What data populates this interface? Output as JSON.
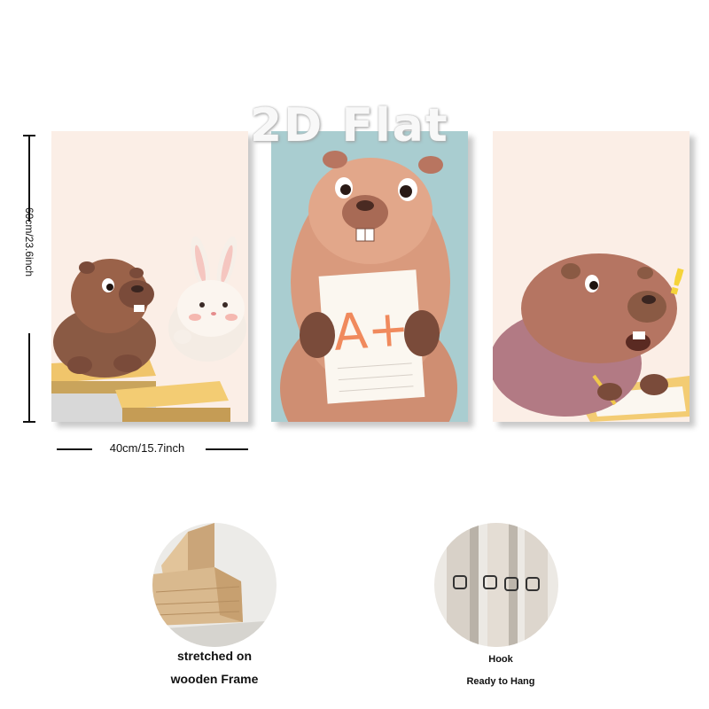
{
  "watermark": {
    "text": "2D Flat"
  },
  "dimensions": {
    "height_label": "60cm/23.6inch",
    "width_label": "40cm/15.7inch"
  },
  "panels": [
    {
      "name": "capybara-and-rabbit-at-desks",
      "background": "#fbeee6"
    },
    {
      "name": "capybara-holding-a-plus-paper",
      "background": "#a9cdd0",
      "paper_text": "A+"
    },
    {
      "name": "capybara-writing-exclamation",
      "background": "#fbeee6",
      "exclamation": "!"
    }
  ],
  "details": {
    "frame": {
      "caption_line1": "stretched on",
      "caption_line2": "wooden Frame"
    },
    "hook": {
      "caption_line1": "Hook",
      "caption_line2": "Ready to Hang"
    }
  },
  "colors": {
    "capybara_brown": "#a66a4d",
    "capybara_dark": "#7a4b3a",
    "grade_orange": "#f08a5d",
    "exclamation_yellow": "#f5d33a",
    "wood": "#d9b98e"
  }
}
